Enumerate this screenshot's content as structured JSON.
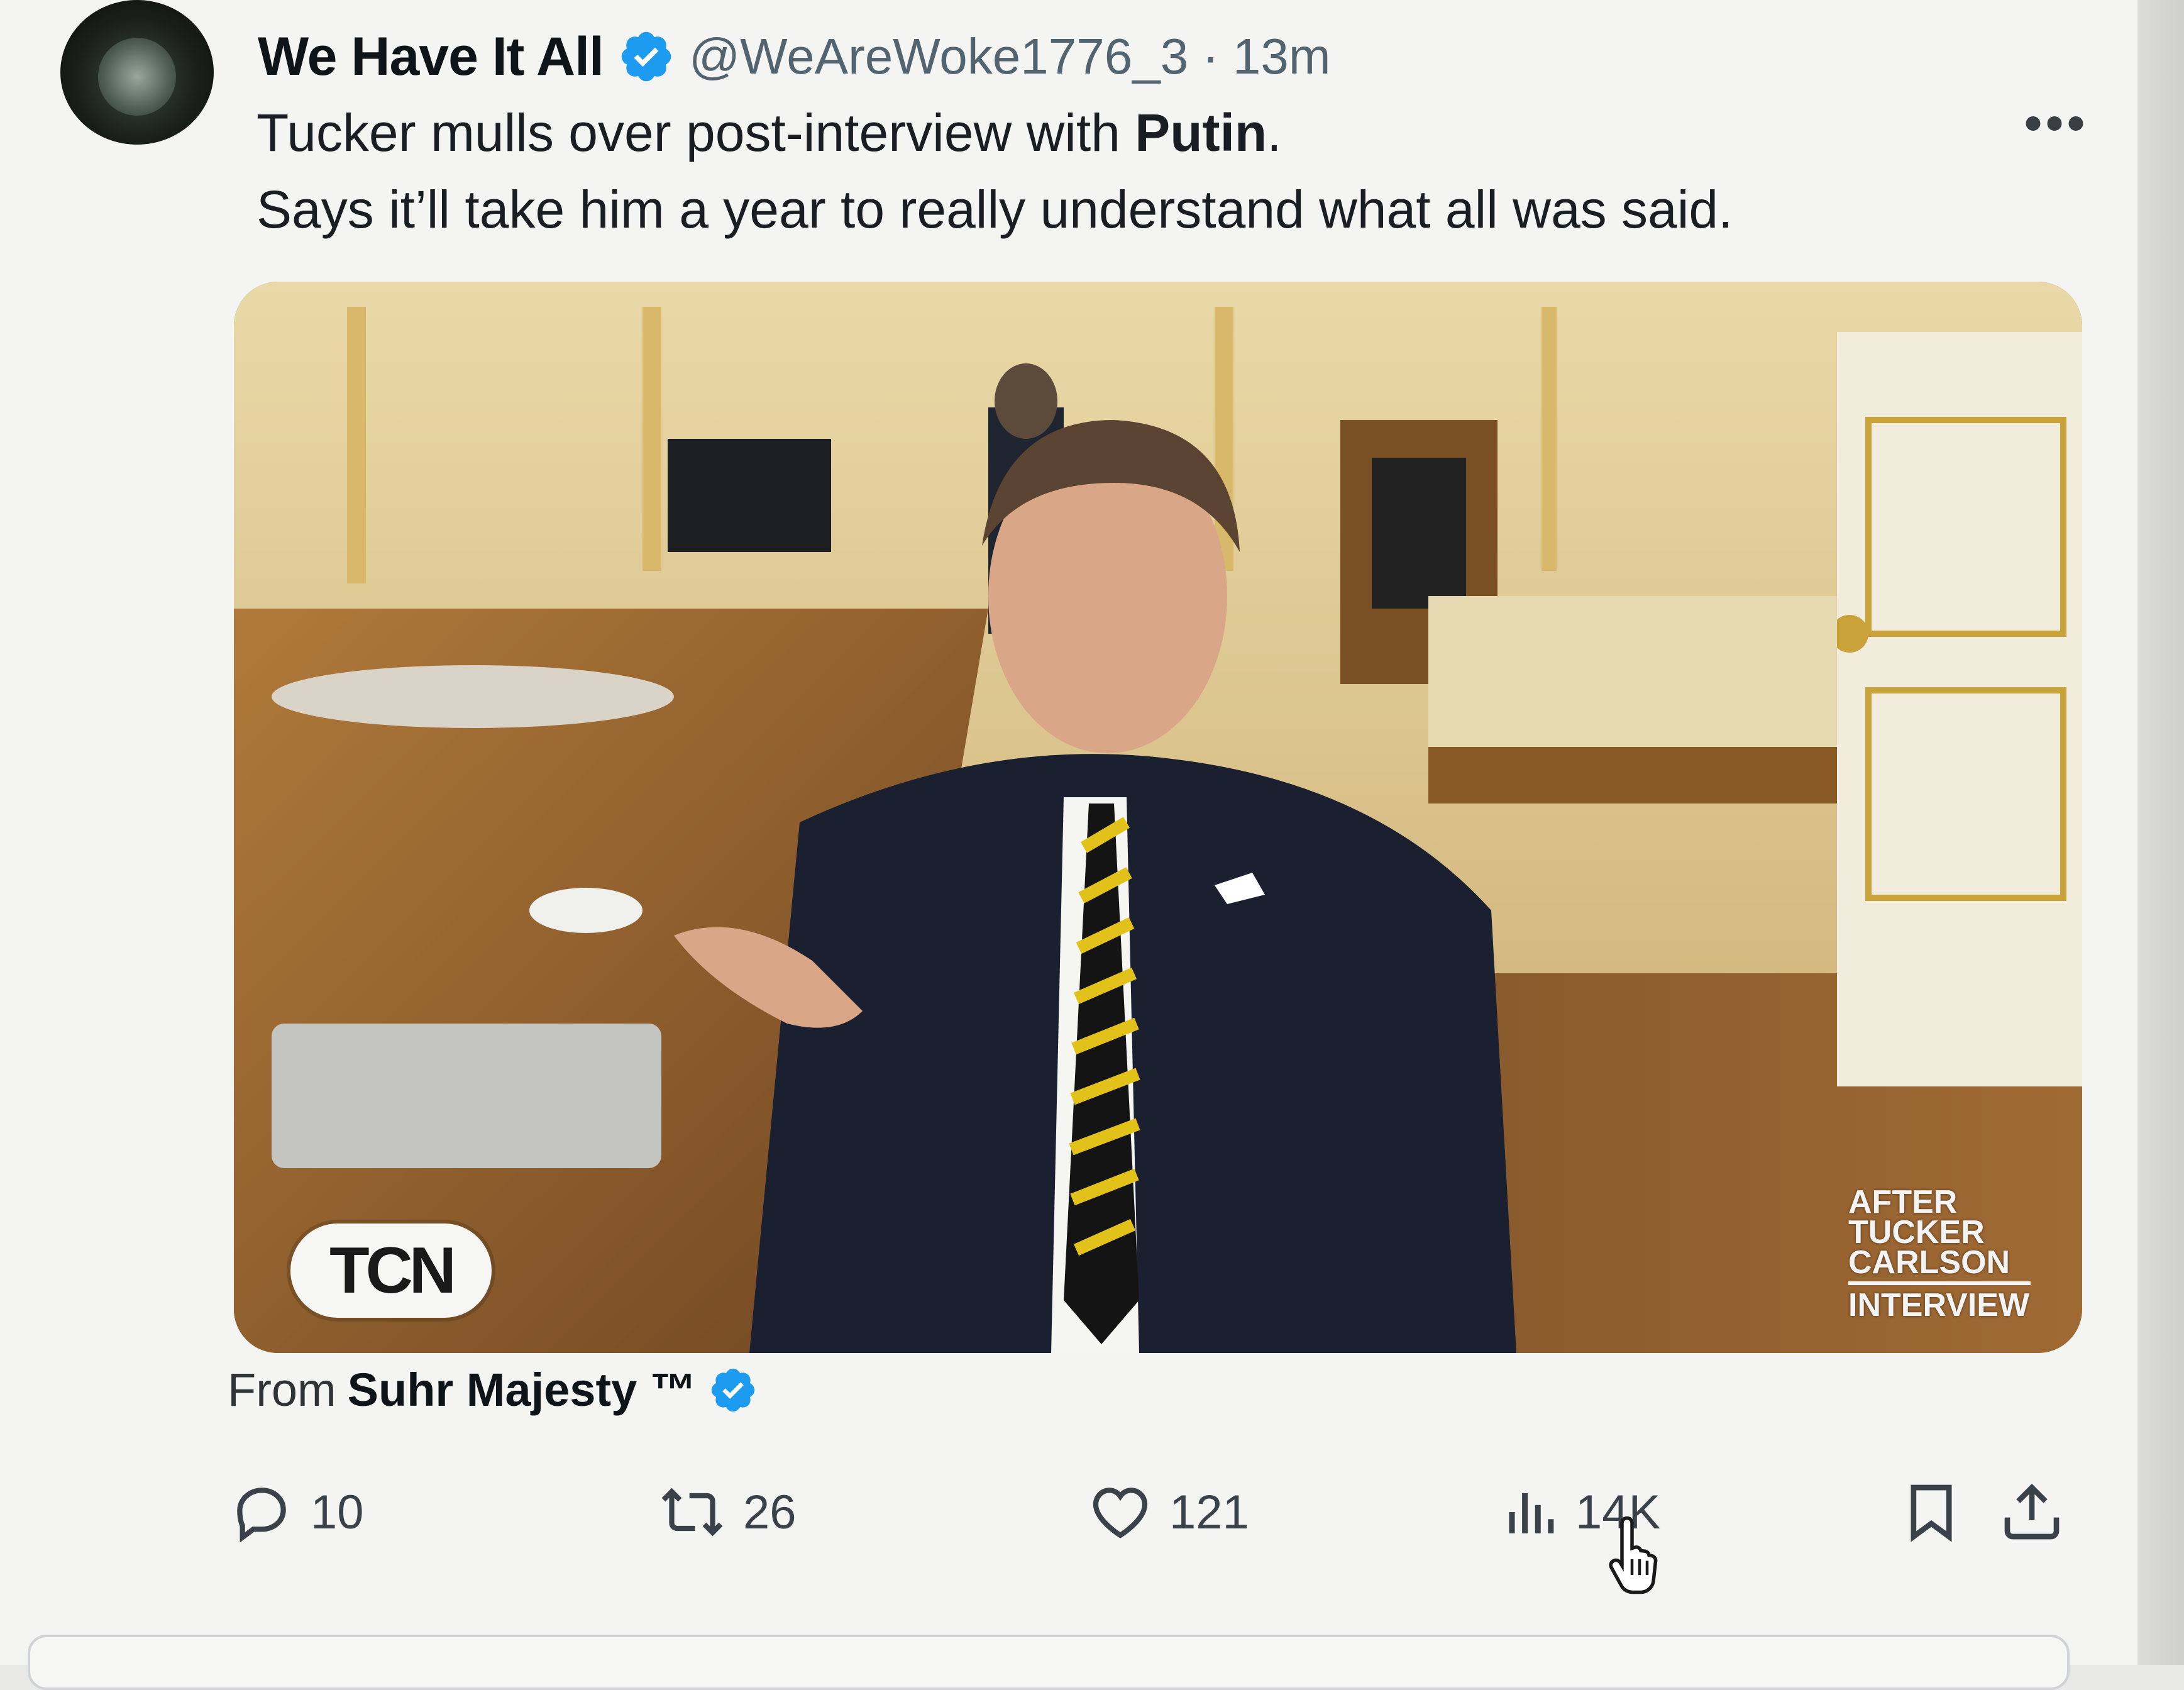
{
  "tweet": {
    "display_name": "We Have It All",
    "handle": "@WeAreWoke1776_3",
    "separator": "·",
    "time": "13m",
    "text_line1_before": "Tucker mulls over post-interview with ",
    "text_line1_bold": "Putin",
    "text_line1_after": ".",
    "text_line2": "Says it’ll take him a year to really understand what all was said.",
    "more_label": "•••"
  },
  "media": {
    "tcn_badge": "TCN",
    "logo_lines": [
      "AFTER",
      "TUCKER",
      "CARLSON",
      "INTERVIEW"
    ]
  },
  "source": {
    "from_label": "From",
    "name": "Suhr Majesty ™"
  },
  "actions": {
    "replies": "10",
    "reposts": "26",
    "likes": "121",
    "views": "14K"
  },
  "colors": {
    "verified": "#1d9bf0",
    "text": "#0f1419",
    "muted": "#536471"
  },
  "icons": [
    "verified-badge-icon",
    "reply-icon",
    "repost-icon",
    "like-icon",
    "views-icon",
    "bookmark-icon",
    "share-icon",
    "hand-cursor-icon"
  ]
}
